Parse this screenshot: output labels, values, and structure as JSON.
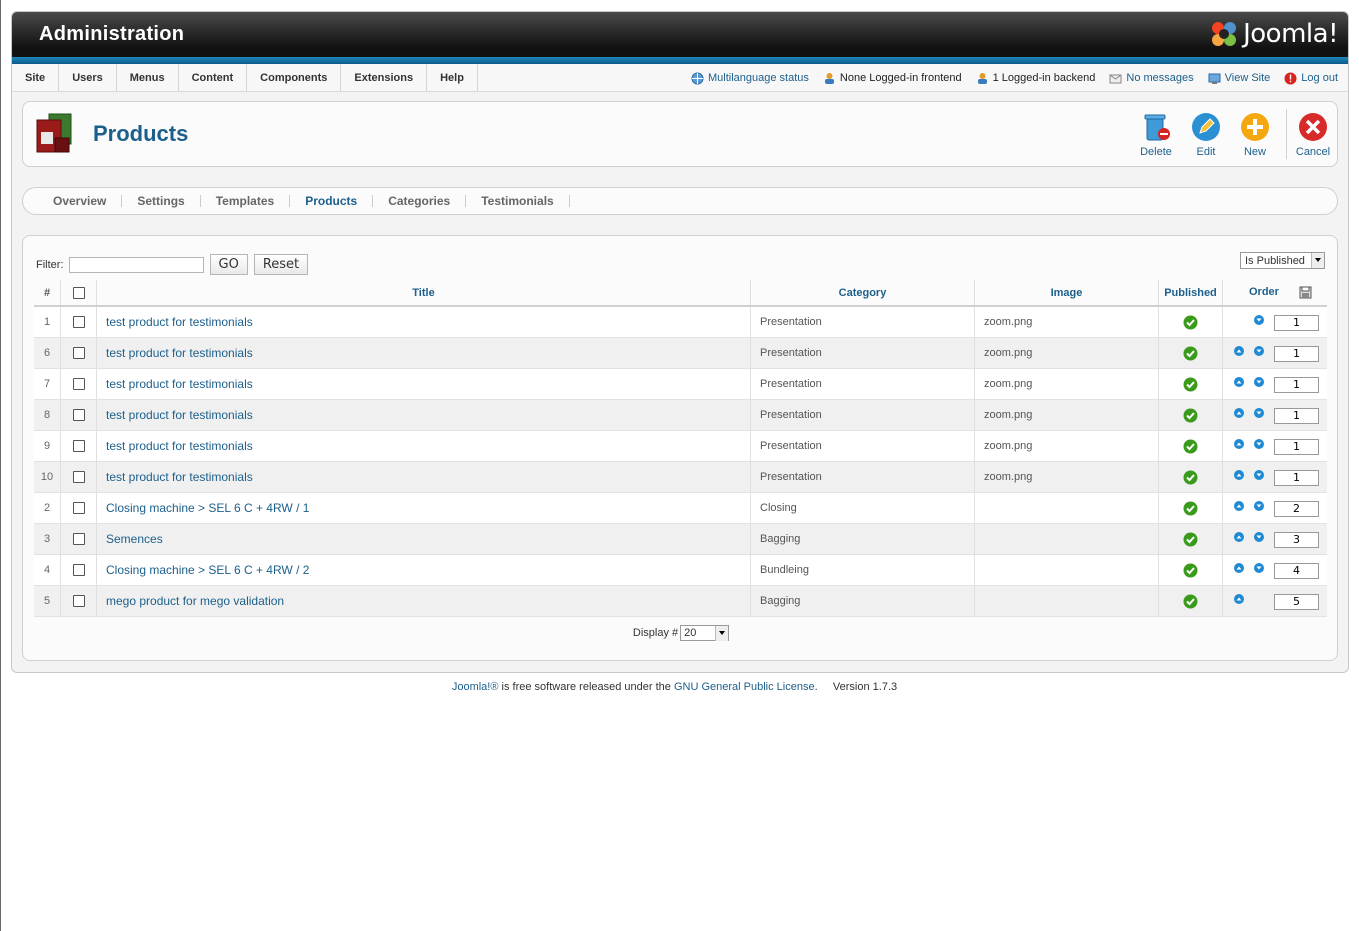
{
  "header": {
    "title": "Administration",
    "logo_text": "Joomla!"
  },
  "menubar": {
    "items": [
      "Site",
      "Users",
      "Menus",
      "Content",
      "Components",
      "Extensions",
      "Help"
    ],
    "status": {
      "multilanguage": "Multilanguage status",
      "frontend": "None Logged-in frontend",
      "backend": "1 Logged-in backend",
      "messages": "No messages",
      "view_site": "View Site",
      "logout": "Log out"
    }
  },
  "toolbar": {
    "title": "Products",
    "delete": "Delete",
    "edit": "Edit",
    "new": "New",
    "cancel": "Cancel"
  },
  "submenu": [
    "Overview",
    "Settings",
    "Templates",
    "Products",
    "Categories",
    "Testimonials"
  ],
  "filter": {
    "label": "Filter:",
    "value": "",
    "go": "GO",
    "reset": "Reset",
    "state": "Is Published"
  },
  "table": {
    "headers": {
      "num": "#",
      "title": "Title",
      "category": "Category",
      "image": "Image",
      "published": "Published",
      "order": "Order"
    },
    "rows": [
      {
        "num": "1",
        "title": "test product for testimonials",
        "category": "Presentation",
        "image": "zoom.png",
        "order": "1"
      },
      {
        "num": "6",
        "title": "test product for testimonials",
        "category": "Presentation",
        "image": "zoom.png",
        "order": "1"
      },
      {
        "num": "7",
        "title": "test product for testimonials",
        "category": "Presentation",
        "image": "zoom.png",
        "order": "1"
      },
      {
        "num": "8",
        "title": "test product for testimonials",
        "category": "Presentation",
        "image": "zoom.png",
        "order": "1"
      },
      {
        "num": "9",
        "title": "test product for testimonials",
        "category": "Presentation",
        "image": "zoom.png",
        "order": "1"
      },
      {
        "num": "10",
        "title": "test product for testimonials",
        "category": "Presentation",
        "image": "zoom.png",
        "order": "1"
      },
      {
        "num": "2",
        "title": "Closing machine > SEL 6 C + 4RW / 1",
        "category": "Closing",
        "image": "",
        "order": "2"
      },
      {
        "num": "3",
        "title": "Semences",
        "category": "Bagging",
        "image": "",
        "order": "3"
      },
      {
        "num": "4",
        "title": "Closing machine > SEL 6 C + 4RW / 2",
        "category": "Bundleing",
        "image": "",
        "order": "4"
      },
      {
        "num": "5",
        "title": "mego product for mego validation",
        "category": "Bagging",
        "image": "",
        "order": "5"
      }
    ]
  },
  "pagination": {
    "label": "Display #",
    "value": "20"
  },
  "footer": {
    "joomla": "Joomla!®",
    "text": " is free software released under the ",
    "license": "GNU General Public License",
    "version": ".     Version 1.7.3"
  },
  "colors": {
    "link": "#1d5f8b",
    "published": "#3a9a1c",
    "arrow": "#1f8ad3"
  }
}
